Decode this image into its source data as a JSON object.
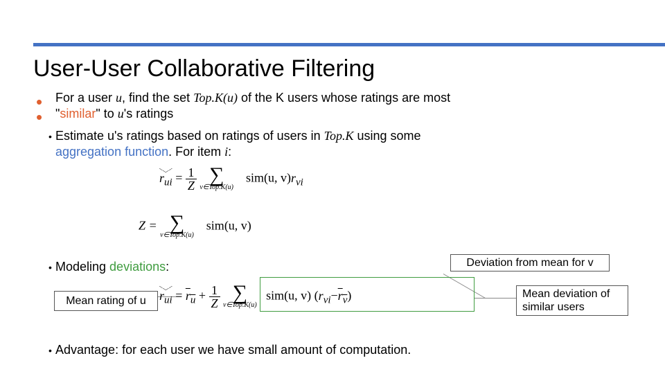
{
  "title": "User-User Collaborative Filtering",
  "bullets": {
    "b1a": "For a user ",
    "b1a_var": "u",
    "b1b": ", find the set ",
    "b1b_fn": "Top.K(u)",
    "b1c": " of the K users whose ratings are most",
    "b1d_open": "\"",
    "b1d_word": "similar",
    "b1d_close": "\" to ",
    "b1d_var": "u",
    "b1d_end": "'s ratings",
    "b2a": "Estimate u's ratings based on ratings of users in ",
    "b2a_fn": "Top.K",
    "b2b": " using some",
    "b2c_word": "aggregation function",
    "b2c_rest": ". For item ",
    "b2c_var": "i",
    "b2c_end": ":",
    "b3a": "Modeling ",
    "b3b": "deviations",
    "b3c": ":",
    "b4": "Advantage: for each user we have small amount of computation."
  },
  "labels": {
    "dev_from_mean": "Deviation from mean for v",
    "mean_rating_u": "Mean rating of u",
    "mean_dev": "Mean deviation of similar users"
  },
  "formula1": {
    "lhs_hat": "r",
    "lhs_sub": "ui",
    "eq": " = ",
    "frac_num": "1",
    "frac_den": "Z",
    "sum_sub": "v∈Top.K(u)",
    "sim": "sim",
    "sim_args": "(u, v)",
    "r": "r",
    "r_sub": "vi"
  },
  "formula2": {
    "Z": "Z = ",
    "sum_sub": "v∈Top.K(u)",
    "sim": "sim",
    "sim_args": "(u, v)"
  },
  "formula3": {
    "lhs_hat": "r",
    "lhs_sub": "ui",
    "eq": " = ",
    "rbar_u": "r",
    "rbar_u_sub": "u",
    "plus": " + ",
    "frac_num": "1",
    "frac_den": "Z",
    "sum_sub": "v∈Top.K(u)",
    "sim": "sim",
    "sim_args": "(u, v)",
    "open": "(",
    "r_vi": "r",
    "r_vi_sub": "vi",
    "minus": "−",
    "rbar_v": "r",
    "rbar_v_sub": "v",
    "close": ")"
  }
}
